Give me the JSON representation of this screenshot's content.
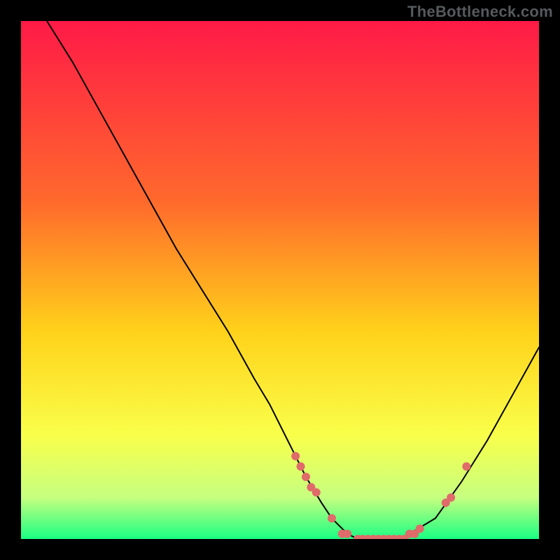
{
  "watermark": "TheBottleneck.com",
  "chart_data": {
    "type": "line",
    "title": "",
    "xlabel": "",
    "ylabel": "",
    "xlim": [
      0,
      100
    ],
    "ylim": [
      0,
      100
    ],
    "grid": false,
    "legend": false,
    "gradient_stops": [
      {
        "offset": 0,
        "color": "#ff1a47"
      },
      {
        "offset": 35,
        "color": "#ff6a2c"
      },
      {
        "offset": 60,
        "color": "#ffd21a"
      },
      {
        "offset": 80,
        "color": "#f9ff4a"
      },
      {
        "offset": 92,
        "color": "#c6ff80"
      },
      {
        "offset": 100,
        "color": "#1aff82"
      }
    ],
    "series": [
      {
        "name": "bottleneck-curve",
        "color": "#000000",
        "stroke_width": 2,
        "x": [
          5,
          10,
          15,
          20,
          25,
          30,
          35,
          40,
          45,
          48,
          50,
          53,
          55,
          58,
          60,
          63,
          65,
          68,
          70,
          73,
          75,
          80,
          85,
          90,
          95,
          100
        ],
        "y": [
          100,
          92,
          83,
          74,
          65,
          56,
          48,
          40,
          31,
          26,
          22,
          16,
          12,
          7,
          4,
          1,
          0,
          0,
          0,
          0,
          1,
          4,
          11,
          19,
          28,
          37
        ]
      }
    ],
    "markers": {
      "name": "highlight-points",
      "color": "#e06b6b",
      "radius": 6,
      "x": [
        53,
        54,
        55,
        56,
        57,
        60,
        62,
        63,
        65,
        66,
        67,
        68,
        69,
        70,
        71,
        72,
        73,
        74,
        75,
        76,
        77,
        82,
        83,
        86
      ],
      "y": [
        16,
        14,
        12,
        10,
        9,
        4,
        1,
        1,
        0,
        0,
        0,
        0,
        0,
        0,
        0,
        0,
        0,
        0,
        1,
        1,
        2,
        7,
        8,
        14
      ]
    }
  }
}
